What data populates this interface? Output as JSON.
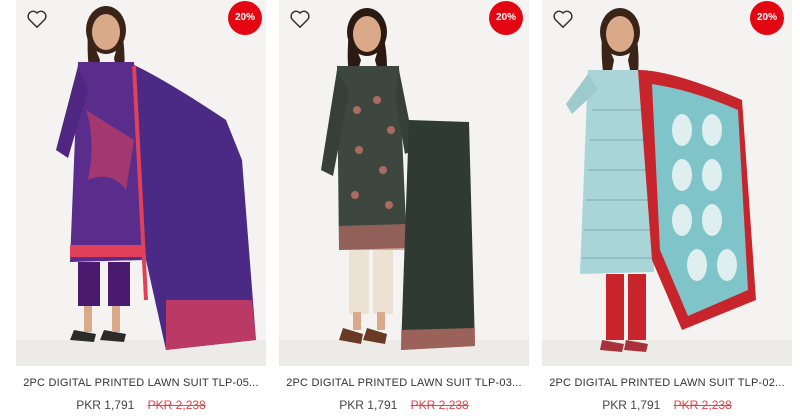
{
  "products": [
    {
      "name": "2PC DIGITAL PRINTED LAWN SUIT TLP-05...",
      "price": "PKR 1,791",
      "old_price": "PKR 2,238",
      "discount": "20%",
      "wishlist_icon": "heart-outline-icon",
      "colors": {
        "suit": "#5a2d8c",
        "dupatta": "#4b2a86",
        "accent": "#e0405a",
        "trouser": "#4a1a6e"
      }
    },
    {
      "name": "2PC DIGITAL PRINTED LAWN SUIT TLP-03...",
      "price": "PKR 1,791",
      "old_price": "PKR 2,238",
      "discount": "20%",
      "wishlist_icon": "heart-outline-icon",
      "colors": {
        "suit": "#3d463f",
        "dupatta": "#2f3a33",
        "accent": "#c9736a",
        "trouser": "#ece2d3"
      }
    },
    {
      "name": "2PC DIGITAL PRINTED LAWN SUIT TLP-02...",
      "price": "PKR 1,791",
      "old_price": "PKR 2,238",
      "discount": "20%",
      "wishlist_icon": "heart-outline-icon",
      "colors": {
        "suit": "#a9d5d8",
        "dupatta": "#7ec4c8",
        "accent": "#c8242c",
        "trouser": "#c8242c"
      }
    }
  ],
  "theme": {
    "badge": "#e30613",
    "old_price": "#e2444a",
    "photo_bg": "#f4f3f1"
  }
}
